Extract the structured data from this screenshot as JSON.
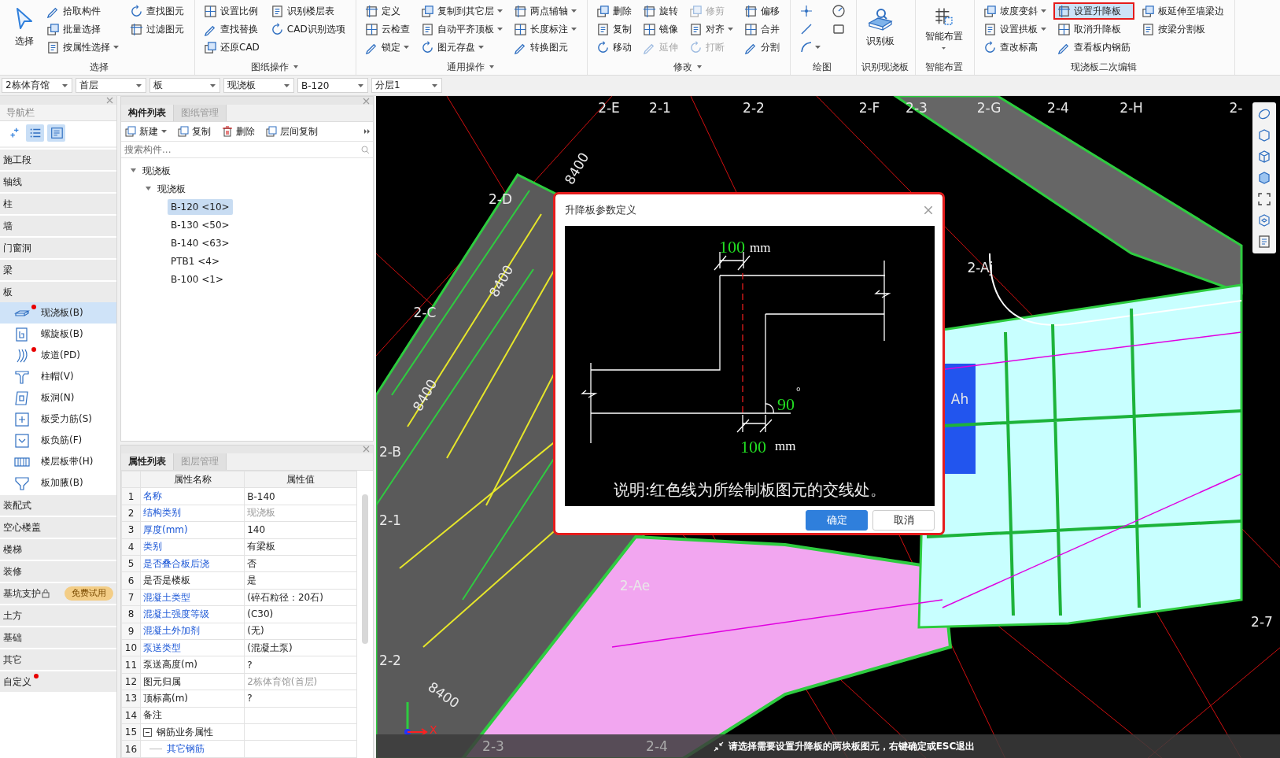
{
  "ribbon": {
    "groups": [
      {
        "label": "选择",
        "dropdown": false,
        "columns": [
          [
            {
              "kind": "big",
              "label": "选择",
              "dropdown": false,
              "disabled": false,
              "selected": false,
              "highlighted": false
            }
          ],
          [
            {
              "kind": "small",
              "label": "拾取构件",
              "dropdown": false,
              "disabled": false,
              "selected": false,
              "highlighted": false
            },
            {
              "kind": "small",
              "label": "批量选择",
              "dropdown": false,
              "disabled": false,
              "selected": false,
              "highlighted": false
            },
            {
              "kind": "small",
              "label": "按属性选择",
              "dropdown": true,
              "disabled": false,
              "selected": false,
              "highlighted": false
            }
          ],
          [
            {
              "kind": "small",
              "label": "查找图元",
              "dropdown": false,
              "disabled": false,
              "selected": false,
              "highlighted": false
            },
            {
              "kind": "small",
              "label": "过滤图元",
              "dropdown": false,
              "disabled": false,
              "selected": false,
              "highlighted": false
            }
          ]
        ]
      },
      {
        "label": "图纸操作",
        "dropdown": true,
        "columns": [
          [
            {
              "kind": "small",
              "label": "设置比例",
              "dropdown": false,
              "disabled": false,
              "selected": false,
              "highlighted": false
            },
            {
              "kind": "small",
              "label": "查找替换",
              "dropdown": false,
              "disabled": false,
              "selected": false,
              "highlighted": false
            },
            {
              "kind": "small",
              "label": "还原CAD",
              "dropdown": false,
              "disabled": false,
              "selected": false,
              "highlighted": false
            }
          ],
          [
            {
              "kind": "small",
              "label": "识别楼层表",
              "dropdown": false,
              "disabled": false,
              "selected": false,
              "highlighted": false
            },
            {
              "kind": "small",
              "label": "CAD识别选项",
              "dropdown": false,
              "disabled": false,
              "selected": false,
              "highlighted": false
            }
          ]
        ]
      },
      {
        "label": "通用操作",
        "dropdown": true,
        "columns": [
          [
            {
              "kind": "small",
              "label": "定义",
              "dropdown": false,
              "disabled": false,
              "selected": false,
              "highlighted": false
            },
            {
              "kind": "small",
              "label": "云检查",
              "dropdown": false,
              "disabled": false,
              "selected": false,
              "highlighted": false
            },
            {
              "kind": "small",
              "label": "锁定",
              "dropdown": true,
              "disabled": false,
              "selected": false,
              "highlighted": false
            }
          ],
          [
            {
              "kind": "small",
              "label": "复制到其它层",
              "dropdown": true,
              "disabled": false,
              "selected": false,
              "highlighted": false
            },
            {
              "kind": "small",
              "label": "自动平齐顶板",
              "dropdown": true,
              "disabled": false,
              "selected": false,
              "highlighted": false
            },
            {
              "kind": "small",
              "label": "图元存盘",
              "dropdown": true,
              "disabled": false,
              "selected": false,
              "highlighted": false
            }
          ],
          [
            {
              "kind": "small",
              "label": "两点辅轴",
              "dropdown": true,
              "disabled": false,
              "selected": false,
              "highlighted": false
            },
            {
              "kind": "small",
              "label": "长度标注",
              "dropdown": true,
              "disabled": false,
              "selected": false,
              "highlighted": false
            },
            {
              "kind": "small",
              "label": "转换图元",
              "dropdown": false,
              "disabled": false,
              "selected": false,
              "highlighted": false
            }
          ]
        ]
      },
      {
        "label": "修改",
        "dropdown": true,
        "columns": [
          [
            {
              "kind": "small",
              "label": "删除",
              "dropdown": false,
              "disabled": false,
              "selected": false,
              "highlighted": false
            },
            {
              "kind": "small",
              "label": "复制",
              "dropdown": false,
              "disabled": false,
              "selected": false,
              "highlighted": false
            },
            {
              "kind": "small",
              "label": "移动",
              "dropdown": false,
              "disabled": false,
              "selected": false,
              "highlighted": false
            }
          ],
          [
            {
              "kind": "small",
              "label": "旋转",
              "dropdown": false,
              "disabled": false,
              "selected": false,
              "highlighted": false
            },
            {
              "kind": "small",
              "label": "镜像",
              "dropdown": false,
              "disabled": false,
              "selected": false,
              "highlighted": false
            },
            {
              "kind": "small",
              "label": "延伸",
              "dropdown": false,
              "disabled": true,
              "selected": false,
              "highlighted": false
            }
          ],
          [
            {
              "kind": "small",
              "label": "修剪",
              "dropdown": false,
              "disabled": true,
              "selected": false,
              "highlighted": false
            },
            {
              "kind": "small",
              "label": "对齐",
              "dropdown": true,
              "disabled": false,
              "selected": false,
              "highlighted": false
            },
            {
              "kind": "small",
              "label": "打断",
              "dropdown": false,
              "disabled": true,
              "selected": false,
              "highlighted": false
            }
          ],
          [
            {
              "kind": "small",
              "label": "偏移",
              "dropdown": false,
              "disabled": false,
              "selected": false,
              "highlighted": false
            },
            {
              "kind": "small",
              "label": "合并",
              "dropdown": false,
              "disabled": false,
              "selected": false,
              "highlighted": false
            },
            {
              "kind": "small",
              "label": "分割",
              "dropdown": false,
              "disabled": false,
              "selected": false,
              "highlighted": false
            }
          ]
        ]
      },
      {
        "label": "绘图",
        "dropdown": false,
        "columns": [
          [
            {
              "kind": "icon",
              "dropdown": false,
              "disabled": false,
              "selected": false,
              "highlighted": false
            },
            {
              "kind": "icon",
              "dropdown": false,
              "disabled": false,
              "selected": false,
              "highlighted": false
            },
            {
              "kind": "icon",
              "dropdown": true,
              "disabled": false,
              "selected": false,
              "highlighted": false
            }
          ],
          [
            {
              "kind": "icon",
              "dropdown": false,
              "disabled": false,
              "selected": false,
              "highlighted": false
            },
            {
              "kind": "icon",
              "dropdown": false,
              "disabled": false,
              "selected": false,
              "highlighted": false
            }
          ]
        ]
      },
      {
        "label": "识别现浇板",
        "dropdown": false,
        "columns": [
          [
            {
              "kind": "big",
              "label": "识别板",
              "dropdown": false,
              "disabled": false,
              "selected": false,
              "highlighted": false
            }
          ]
        ]
      },
      {
        "label": "智能布置",
        "dropdown": false,
        "columns": [
          [
            {
              "kind": "big",
              "label": "智能布置",
              "dropdown": true,
              "disabled": false,
              "selected": false,
              "highlighted": false
            }
          ]
        ]
      },
      {
        "label": "现浇板二次编辑",
        "dropdown": false,
        "columns": [
          [
            {
              "kind": "small",
              "label": "坡度变斜",
              "dropdown": true,
              "disabled": false,
              "selected": false,
              "highlighted": false
            },
            {
              "kind": "small",
              "label": "设置拱板",
              "dropdown": true,
              "disabled": false,
              "selected": false,
              "highlighted": false
            },
            {
              "kind": "small",
              "label": "查改标高",
              "dropdown": false,
              "disabled": false,
              "selected": false,
              "highlighted": false
            }
          ],
          [
            {
              "kind": "small",
              "label": "设置升降板",
              "dropdown": false,
              "disabled": false,
              "selected": true,
              "highlighted": true
            },
            {
              "kind": "small",
              "label": "取消升降板",
              "dropdown": false,
              "disabled": false,
              "selected": false,
              "highlighted": false
            },
            {
              "kind": "small",
              "label": "查看板内钢筋",
              "dropdown": false,
              "disabled": false,
              "selected": false,
              "highlighted": false
            }
          ],
          [
            {
              "kind": "small",
              "label": "板延伸至墙梁边",
              "dropdown": false,
              "disabled": false,
              "selected": false,
              "highlighted": false
            },
            {
              "kind": "small",
              "label": "按梁分割板",
              "dropdown": false,
              "disabled": false,
              "selected": false,
              "highlighted": false
            }
          ]
        ]
      }
    ]
  },
  "selectors": [
    "2栋体育馆",
    "首层",
    "板",
    "现浇板",
    "B-120",
    "分层1"
  ],
  "nav": {
    "title": "导航栏",
    "view_buttons": [
      {
        "selected": false
      },
      {
        "selected": true
      },
      {
        "selected": true
      }
    ],
    "categories": [
      {
        "label": "施工段",
        "flagged": false,
        "locked": false
      },
      {
        "label": "轴线",
        "flagged": false,
        "locked": false
      },
      {
        "label": "柱",
        "flagged": false,
        "locked": false
      },
      {
        "label": "墙",
        "flagged": false,
        "locked": false
      },
      {
        "label": "门窗洞",
        "flagged": false,
        "locked": false
      },
      {
        "label": "梁",
        "flagged": false,
        "locked": false
      },
      {
        "label": "板",
        "flagged": false,
        "locked": false,
        "children": [
          {
            "label": "现浇板(B)",
            "selected": true,
            "flagged": true
          },
          {
            "label": "螺旋板(B)",
            "selected": false,
            "flagged": false
          },
          {
            "label": "坡道(PD)",
            "selected": false,
            "flagged": true
          },
          {
            "label": "柱帽(V)",
            "selected": false,
            "flagged": false
          },
          {
            "label": "板洞(N)",
            "selected": false,
            "flagged": false
          },
          {
            "label": "板受力筋(S)",
            "selected": false,
            "flagged": false
          },
          {
            "label": "板负筋(F)",
            "selected": false,
            "flagged": false
          },
          {
            "label": "楼层板带(H)",
            "selected": false,
            "flagged": false
          },
          {
            "label": "板加腋(B)",
            "selected": false,
            "flagged": false
          }
        ]
      },
      {
        "label": "装配式",
        "flagged": false,
        "locked": false
      },
      {
        "label": "空心楼盖",
        "flagged": false,
        "locked": false
      },
      {
        "label": "楼梯",
        "flagged": false,
        "locked": false
      },
      {
        "label": "装修",
        "flagged": false,
        "locked": false
      },
      {
        "label": "基坑支护",
        "flagged": false,
        "locked": true,
        "badge": "免费试用"
      },
      {
        "label": "土方",
        "flagged": false,
        "locked": false
      },
      {
        "label": "基础",
        "flagged": false,
        "locked": false
      },
      {
        "label": "其它",
        "flagged": false,
        "locked": false
      },
      {
        "label": "自定义",
        "flagged": true,
        "locked": false
      }
    ]
  },
  "components": {
    "tabs": [
      {
        "label": "构件列表",
        "selected": true
      },
      {
        "label": "图纸管理",
        "selected": false
      }
    ],
    "toolbar": [
      {
        "label": "新建",
        "dropdown": true
      },
      {
        "label": "复制",
        "dropdown": false
      },
      {
        "label": "删除",
        "dropdown": false
      },
      {
        "label": "层间复制",
        "dropdown": false
      }
    ],
    "search": {
      "placeholder": "搜索构件..."
    },
    "tree": [
      {
        "label": "现浇板",
        "expanded": true,
        "selected": false,
        "children": [
          {
            "label": "现浇板",
            "expanded": true,
            "selected": false,
            "children": [
              {
                "label": "B-120 <10>",
                "selected": true
              },
              {
                "label": "B-130 <50>",
                "selected": false
              },
              {
                "label": "B-140 <63>",
                "selected": false
              },
              {
                "label": "PTB1 <4>",
                "selected": false
              },
              {
                "label": "B-100 <1>",
                "selected": false
              }
            ]
          }
        ]
      }
    ]
  },
  "properties": {
    "tabs": [
      {
        "label": "属性列表",
        "selected": true
      },
      {
        "label": "图层管理",
        "selected": false
      }
    ],
    "columns": [
      "属性名称",
      "属性值"
    ],
    "rows": [
      {
        "num": "1",
        "kind": "field",
        "name": "名称",
        "value": "B-140",
        "blue": true,
        "muted": false
      },
      {
        "num": "2",
        "kind": "field",
        "name": "结构类别",
        "value": "现浇板",
        "blue": true,
        "muted": true
      },
      {
        "num": "3",
        "kind": "field",
        "name": "厚度(mm)",
        "value": "140",
        "blue": true,
        "muted": false
      },
      {
        "num": "4",
        "kind": "field",
        "name": "类别",
        "value": "有梁板",
        "blue": true,
        "muted": false
      },
      {
        "num": "5",
        "kind": "field",
        "name": "是否叠合板后浇",
        "value": "否",
        "blue": true,
        "muted": false
      },
      {
        "num": "6",
        "kind": "field",
        "name": "是否是楼板",
        "value": "是",
        "blue": false,
        "muted": false
      },
      {
        "num": "7",
        "kind": "field",
        "name": "混凝土类型",
        "value": "(碎石粒径：20石)",
        "blue": true,
        "muted": false
      },
      {
        "num": "8",
        "kind": "field",
        "name": "混凝土强度等级",
        "value": "(C30)",
        "blue": true,
        "muted": false
      },
      {
        "num": "9",
        "kind": "field",
        "name": "混凝土外加剂",
        "value": "(无)",
        "blue": true,
        "muted": false
      },
      {
        "num": "10",
        "kind": "field",
        "name": "泵送类型",
        "value": "(混凝土泵)",
        "blue": true,
        "muted": false
      },
      {
        "num": "11",
        "kind": "field",
        "name": "泵送高度(m)",
        "value": "?",
        "blue": false,
        "muted": false
      },
      {
        "num": "12",
        "kind": "field",
        "name": "图元归属",
        "value": "2栋体育馆(首层)",
        "blue": false,
        "muted": true
      },
      {
        "num": "13",
        "kind": "field",
        "name": "顶标高(m)",
        "value": "?",
        "blue": false,
        "muted": false
      },
      {
        "num": "14",
        "kind": "field",
        "name": "备注",
        "blue": false
      },
      {
        "num": "15",
        "kind": "group",
        "name": "钢筋业务属性",
        "expanded": true,
        "blue": false
      },
      {
        "num": "16",
        "kind": "child",
        "name": "其它钢筋",
        "blue": true
      }
    ]
  },
  "canvas": {
    "axis_labels": [
      "2-E",
      "2-1",
      "2-2",
      "2-F",
      "2-3",
      "2-G",
      "2-4",
      "2-H",
      "2-",
      "2-D",
      "2-C",
      "2-B",
      "2-1",
      "2-2",
      "2-Aj",
      "Ah",
      "2-Ae",
      "2-7",
      "2-3",
      "2-4"
    ],
    "dimension_labels": [
      "8400",
      "8400",
      "8400",
      "8400"
    ],
    "axis_x_label": "X",
    "status": "请选择需要设置升降板的两块板图元，右键确定或ESC退出"
  },
  "dialog": {
    "title": "升降板参数定义",
    "highlighted": true,
    "top_value": "100",
    "top_unit": "mm",
    "bottom_value": "100",
    "bottom_unit": "mm",
    "angle": "90",
    "angle_unit": "°",
    "caption": "说明:红色线为所绘制板图元的交线处。",
    "buttons": [
      {
        "label": "确定",
        "primary": true
      },
      {
        "label": "取消",
        "primary": false
      }
    ]
  }
}
